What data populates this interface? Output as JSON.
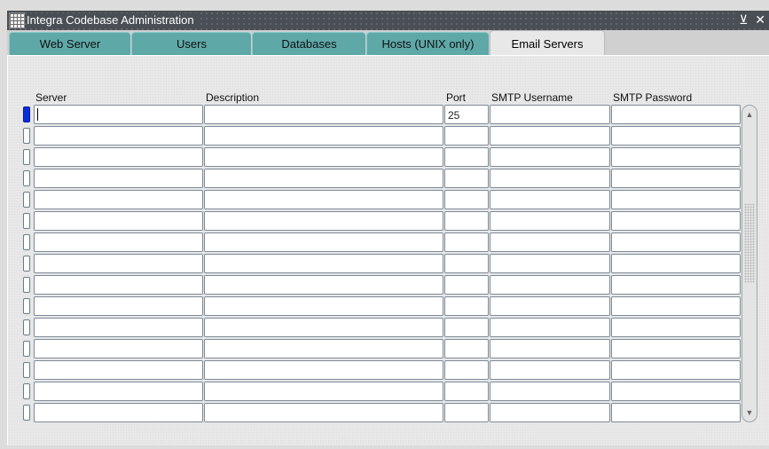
{
  "window": {
    "title": "Integra Codebase Administration",
    "controls": "⊻ ✕"
  },
  "tabs": [
    {
      "label": "Web Server",
      "active": false
    },
    {
      "label": "Users",
      "active": false
    },
    {
      "label": "Databases",
      "active": false
    },
    {
      "label": "Hosts (UNIX only)",
      "active": false
    },
    {
      "label": "Email Servers",
      "active": true
    }
  ],
  "table": {
    "columns": [
      "Server",
      "Description",
      "Port",
      "SMTP Username",
      "SMTP Password"
    ],
    "rows": [
      [
        "",
        "",
        "25",
        "",
        ""
      ],
      [
        "",
        "",
        "",
        "",
        ""
      ],
      [
        "",
        "",
        "",
        "",
        ""
      ],
      [
        "",
        "",
        "",
        "",
        ""
      ],
      [
        "",
        "",
        "",
        "",
        ""
      ],
      [
        "",
        "",
        "",
        "",
        ""
      ],
      [
        "",
        "",
        "",
        "",
        ""
      ],
      [
        "",
        "",
        "",
        "",
        ""
      ],
      [
        "",
        "",
        "",
        "",
        ""
      ],
      [
        "",
        "",
        "",
        "",
        ""
      ],
      [
        "",
        "",
        "",
        "",
        ""
      ],
      [
        "",
        "",
        "",
        "",
        ""
      ],
      [
        "",
        "",
        "",
        "",
        ""
      ],
      [
        "",
        "",
        "",
        "",
        ""
      ],
      [
        "",
        "",
        "",
        "",
        ""
      ]
    ]
  },
  "scrollbar": {
    "up_icon": "arrow-up-icon",
    "down_icon": "arrow-down-icon"
  }
}
